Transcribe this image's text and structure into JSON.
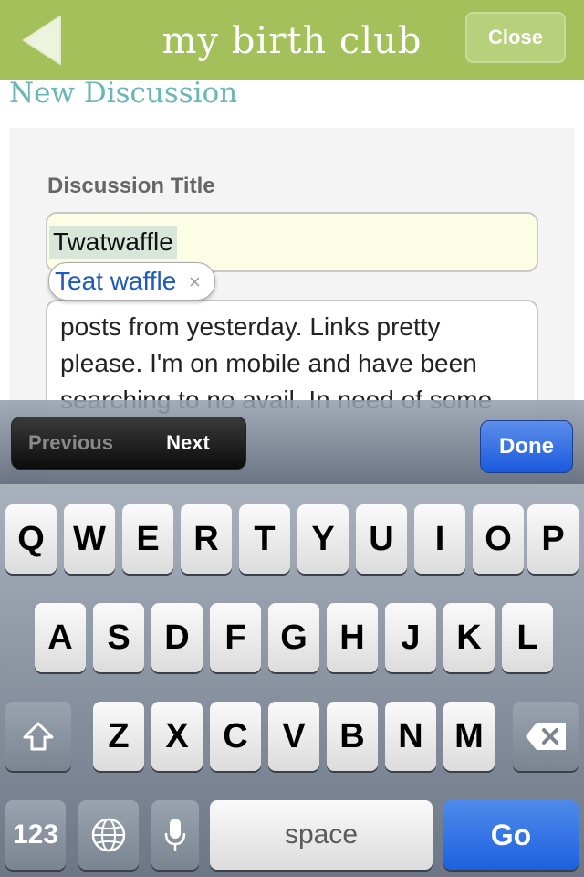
{
  "header": {
    "app_title": "my birth club",
    "close_label": "Close"
  },
  "page": {
    "heading": "New Discussion"
  },
  "form": {
    "title_label": "Discussion Title",
    "title_value": "Twatwaffle",
    "autocorrect_suggestion": "Teat waffle",
    "autocorrect_dismiss": "×",
    "body_text": "posts from yesterday. Links pretty please. I'm on mobile and have been searching to no avail. In need of some entertainment."
  },
  "keyboard_toolbar": {
    "previous_label": "Previous",
    "next_label": "Next",
    "done_label": "Done"
  },
  "keyboard": {
    "row1": [
      "Q",
      "W",
      "E",
      "R",
      "T",
      "Y",
      "U",
      "I",
      "O",
      "P"
    ],
    "row2": [
      "A",
      "S",
      "D",
      "F",
      "G",
      "H",
      "J",
      "K",
      "L"
    ],
    "row3": [
      "Z",
      "X",
      "C",
      "V",
      "B",
      "N",
      "M"
    ],
    "numbers_label": "123",
    "space_label": "space",
    "go_label": "Go",
    "icons": [
      "back-arrow-icon",
      "shift-icon",
      "backspace-icon",
      "globe-icon",
      "microphone-icon"
    ]
  },
  "colors": {
    "header_green": "#a3c05a",
    "heading_teal": "#6bb6b6",
    "go_blue": "#1d61e0"
  }
}
